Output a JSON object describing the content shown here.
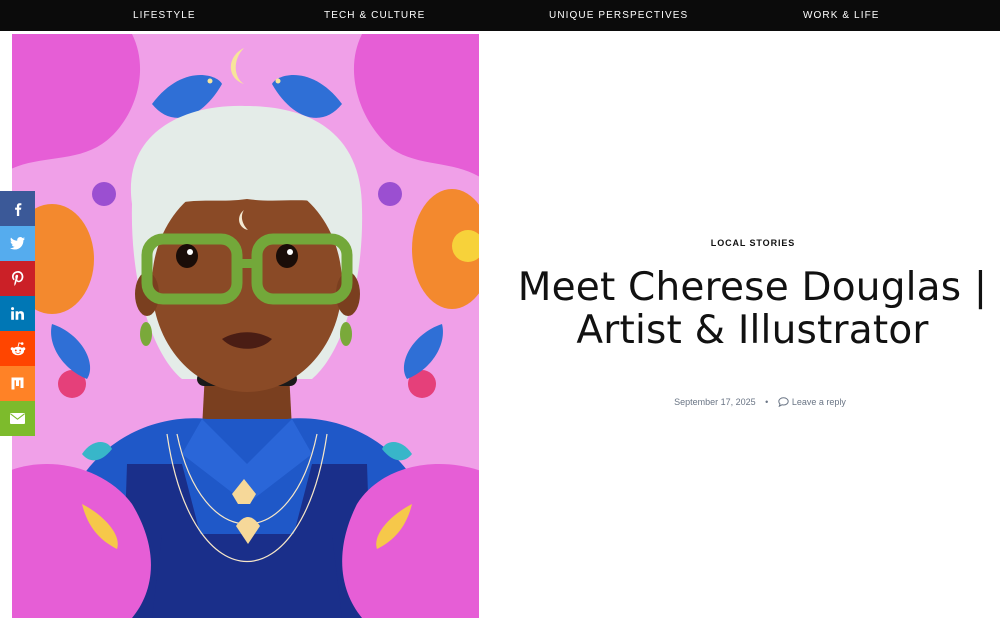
{
  "nav": {
    "items": [
      {
        "label": "LIFESTYLE"
      },
      {
        "label": "TECH & CULTURE"
      },
      {
        "label": "UNIQUE PERSPECTIVES"
      },
      {
        "label": "WORK & LIFE"
      }
    ]
  },
  "share": {
    "buttons": [
      {
        "icon": "facebook-icon",
        "color": "#3b5998"
      },
      {
        "icon": "twitter-icon",
        "color": "#55acee"
      },
      {
        "icon": "pinterest-icon",
        "color": "#cb2027"
      },
      {
        "icon": "linkedin-icon",
        "color": "#0077b5"
      },
      {
        "icon": "reddit-icon",
        "color": "#ff4500"
      },
      {
        "icon": "mix-icon",
        "color": "#ff8226"
      },
      {
        "icon": "email-icon",
        "color": "#7dbb2c"
      }
    ]
  },
  "post": {
    "category": "LOCAL STORIES",
    "title": "Meet Cherese Douglas | Artist & Illustrator",
    "date": "September 17, 2025",
    "separator": "•",
    "reply_label": "Leave a reply"
  },
  "colors": {
    "nav_bg": "#0b0b0b",
    "art_bg": "#f0a0e8",
    "meta_text": "#6a7585"
  }
}
